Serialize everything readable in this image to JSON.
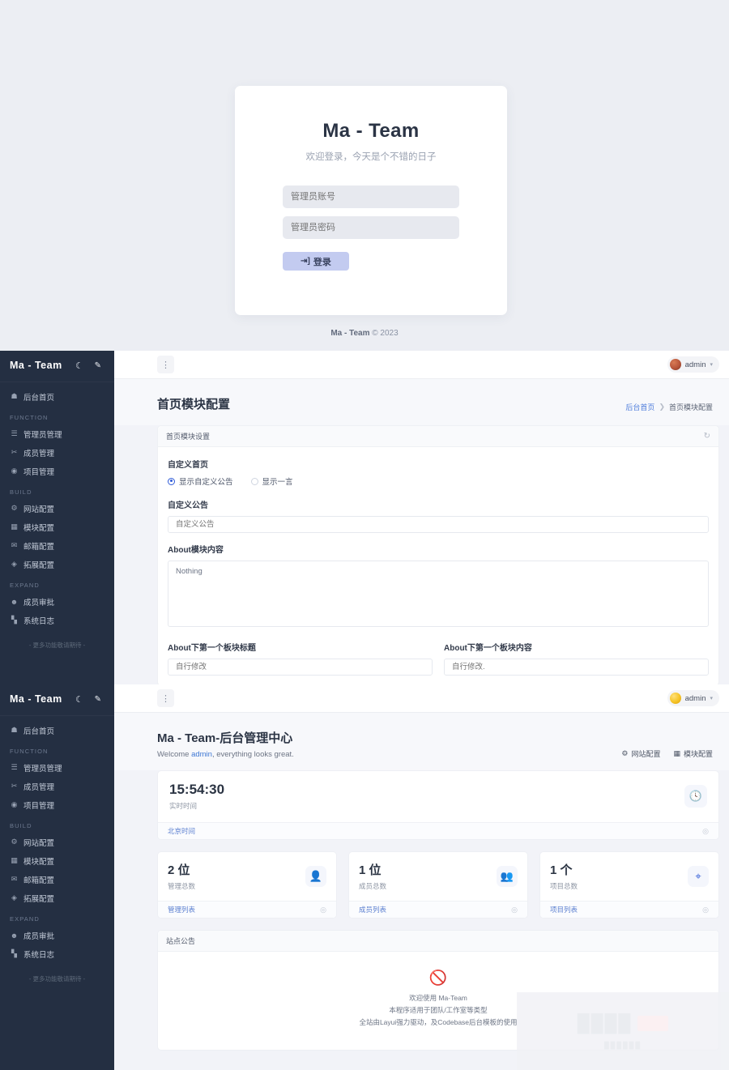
{
  "login": {
    "title": "Ma - Team",
    "subtitle": "欢迎登录，今天是个不错的日子",
    "username_placeholder": "管理员账号",
    "username_value": "",
    "password_placeholder": "管理员密码",
    "password_value": "",
    "submit_label": "登录",
    "submit_icon": "login-arrow-icon",
    "footer": "Ma - Team © 2023",
    "footer_brand": "Ma - Team",
    "footer_copy": "© 2023"
  },
  "sidebar": {
    "brand": "Ma - Team",
    "theme_toggle_icon": "moon-icon",
    "edit_icon": "pencil-icon",
    "home": {
      "label": "后台首页",
      "icon": "home-icon"
    },
    "groups": [
      {
        "title": "FUNCTION",
        "items": [
          {
            "label": "管理员管理",
            "icon": "list-icon"
          },
          {
            "label": "成员管理",
            "icon": "scissors-icon"
          },
          {
            "label": "项目管理",
            "icon": "globe-icon"
          }
        ]
      },
      {
        "title": "BUILD",
        "items": [
          {
            "label": "网站配置",
            "icon": "settings-icon"
          },
          {
            "label": "模块配置",
            "icon": "grid-icon"
          },
          {
            "label": "邮箱配置",
            "icon": "mail-icon"
          },
          {
            "label": "拓展配置",
            "icon": "puzzle-icon"
          }
        ]
      },
      {
        "title": "EXPAND",
        "items": [
          {
            "label": "成员审批",
            "icon": "user-check-icon"
          },
          {
            "label": "系统日志",
            "icon": "chart-icon"
          }
        ]
      }
    ],
    "more_text": "- 更多功能敬请期待 -"
  },
  "topbar": {
    "menu_icon": "dots-vertical-icon",
    "user": "admin",
    "caret_icon": "chevron-down-icon"
  },
  "dash1": {
    "page_title": "首页模块配置",
    "breadcrumb": {
      "root": "后台首页",
      "separator": "❯",
      "current": "首页模块配置"
    },
    "card_title": "首页模块设置",
    "refresh_icon": "refresh-icon",
    "section1_label": "自定义首页",
    "radios": [
      {
        "label": "显示自定义公告",
        "checked": true
      },
      {
        "label": "显示一言",
        "checked": false
      }
    ],
    "notice_label": "自定义公告",
    "notice_placeholder": "自定义公告",
    "notice_value": "",
    "about_label": "About模块内容",
    "about_value": "Nothing",
    "panel_title_label": "About下第一个板块标题",
    "panel_title_placeholder": "自行修改",
    "panel_body_label": "About下第一个板块内容",
    "panel_body_placeholder": "自行修改."
  },
  "dash2": {
    "page_title": "Ma - Team-后台管理中心",
    "welcome_prefix": "Welcome ",
    "welcome_user": "admin",
    "welcome_suffix": ", everything looks great.",
    "head_actions": [
      {
        "label": "网站配置",
        "icon": "gear-icon"
      },
      {
        "label": "模块配置",
        "icon": "grid-icon"
      }
    ],
    "clock": {
      "time": "15:54:30",
      "label": "实时时间",
      "icon": "clock-icon",
      "foot_link": "北京时间",
      "foot_arrow_icon": "arrow-right-icon"
    },
    "stats": [
      {
        "value": "2 位",
        "label": "管理总数",
        "icon": "user-icon",
        "link": "管理列表"
      },
      {
        "value": "1 位",
        "label": "成员总数",
        "icon": "users-icon",
        "link": "成员列表"
      },
      {
        "value": "1 个",
        "label": "项目总数",
        "icon": "share-icon",
        "link": "项目列表"
      }
    ],
    "notice": {
      "title": "站点公告",
      "icon": "no-data-icon",
      "lines": [
        "欢迎使用 Ma-Team",
        "本程序适用于团队/工作室等类型",
        "全站由Layui强力驱动，及Codebase后台模板的使用"
      ]
    }
  },
  "colors": {
    "sidebar_bg": "#242f42",
    "accent": "#3a63d8",
    "link": "#4f7ddb",
    "page_bg": "#f2f3f8"
  }
}
